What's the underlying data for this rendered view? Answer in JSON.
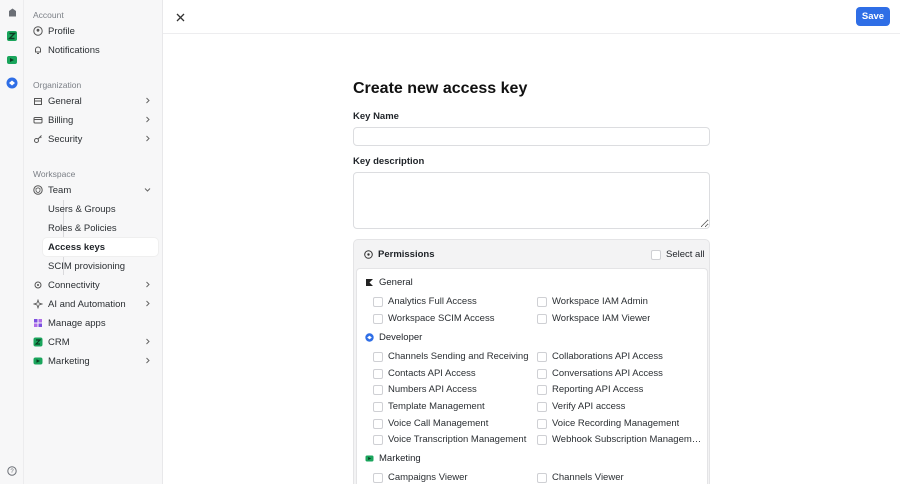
{
  "sidebar": {
    "sections": {
      "account": "Account",
      "organization": "Organization",
      "workspace": "Workspace"
    },
    "items": {
      "profile": "Profile",
      "notifications": "Notifications",
      "general": "General",
      "billing": "Billing",
      "security": "Security",
      "team": "Team",
      "users_groups": "Users & Groups",
      "roles_policies": "Roles & Policies",
      "access_keys": "Access keys",
      "scim": "SCIM provisioning",
      "connectivity": "Connectivity",
      "ai_automation": "AI and Automation",
      "manage_apps": "Manage apps",
      "crm": "CRM",
      "marketing": "Marketing"
    }
  },
  "toolbar": {
    "save_label": "Save"
  },
  "form": {
    "title": "Create new access key",
    "key_name_label": "Key Name",
    "key_name_value": "",
    "key_description_label": "Key description",
    "key_description_value": ""
  },
  "permissions": {
    "title": "Permissions",
    "select_all": "Select all",
    "groups": {
      "general": {
        "name": "General",
        "items": [
          "Analytics Full Access",
          "Workspace IAM Admin",
          "Workspace SCIM Access",
          "Workspace IAM Viewer"
        ]
      },
      "developer": {
        "name": "Developer",
        "items": [
          "Channels Sending and Receiving",
          "Collaborations API Access",
          "Contacts API Access",
          "Conversations API Access",
          "Numbers API Access",
          "Reporting API Access",
          "Template Management",
          "Verify API access",
          "Voice Call Management",
          "Voice Recording Management",
          "Voice Transcription Management",
          "Webhook Subscription Management"
        ]
      },
      "marketing": {
        "name": "Marketing",
        "items": [
          "Campaigns Viewer",
          "Channels Viewer"
        ]
      }
    }
  },
  "colors": {
    "accent": "#2f6ee6",
    "crm_green": "#1aa55c",
    "apps_purple": "#7b4fe0",
    "developer_blue": "#2f6ee6"
  }
}
